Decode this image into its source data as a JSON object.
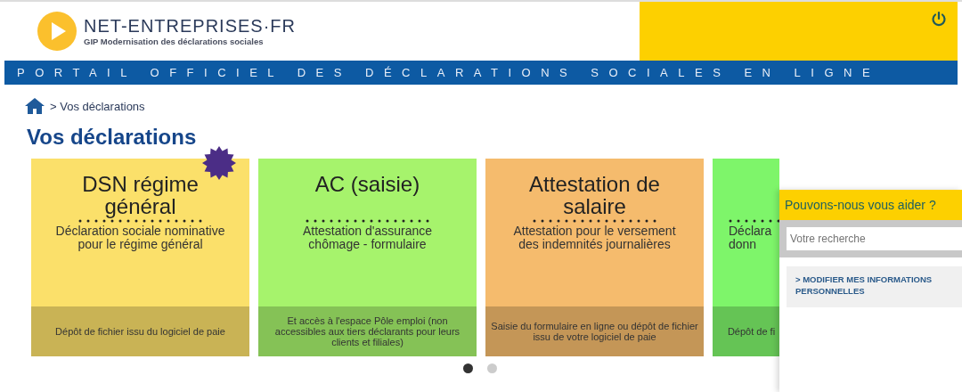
{
  "header": {
    "logo_title": "NET-ENTREPRISES·FR",
    "logo_subtitle": "GIP Modernisation des déclarations sociales"
  },
  "banner": {
    "text": "PORTAIL OFFICIEL DES DÉCLARATIONS SOCIALES EN LIGNE"
  },
  "breadcrumb": {
    "current": "> Vos déclarations"
  },
  "heading": "Vos déclarations",
  "cards": [
    {
      "title": "DSN régime général",
      "description": [
        "Déclaration sociale nominative",
        "pour le régime général"
      ],
      "footer": "Dépôt de fichier issu du logiciel de paie",
      "color": "#fbe06a",
      "new_badge": true
    },
    {
      "title": "AC (saisie)",
      "description": [
        "Attestation d'assurance",
        "chômage - formulaire"
      ],
      "footer": "Et accès à l'espace Pôle emploi (non accessibles aux tiers déclarants pour leurs clients et filiales)",
      "color": "#a6f36c",
      "new_badge": false
    },
    {
      "title": "Attestation de salaire",
      "description": [
        "Attestation pour le versement",
        "des indemnités journalières"
      ],
      "footer": "Saisie du formulaire en ligne ou dépôt de fichier issu de votre logiciel de paie",
      "color": "#f5bb6d",
      "new_badge": false
    },
    {
      "description": [
        "Déclara",
        "donn"
      ],
      "footer": "Dépôt de fi",
      "color": "#7ef56a",
      "new_badge": false
    }
  ],
  "pagination": [
    {
      "selected": true
    },
    {
      "selected": false
    }
  ],
  "help_panel": {
    "title": "Pouvons-nous vous aider ?",
    "search": {
      "placeholder": "Votre recherche"
    },
    "link": "> MODIFIER MES INFORMATIONS PERSONNELLES"
  }
}
